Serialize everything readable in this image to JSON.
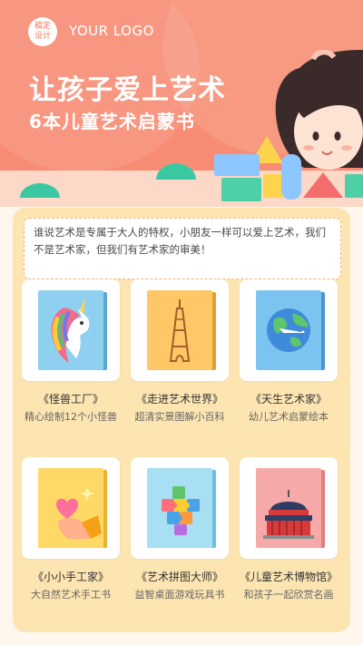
{
  "header": {
    "logo_badge_line1": "稿定",
    "logo_badge_line2": "设计",
    "logo_text": "YOUR LOGO",
    "title": "让孩子爱上艺术",
    "subtitle": "6本儿童艺术启蒙书"
  },
  "intro": {
    "text": "谁说艺术是专属于大人的特权，小朋友一样可以爱上艺术，我们不是艺术家，但我们有艺术家的审美！"
  },
  "books": [
    {
      "title": "《怪兽工厂》",
      "desc": "精心绘制12个小怪兽",
      "icon": "unicorn-icon",
      "cover_color": "#8fd0f0"
    },
    {
      "title": "《走进艺术世界》",
      "desc": "超清实景图解小百科",
      "icon": "eiffel-tower-icon",
      "cover_color": "#ffc766"
    },
    {
      "title": "《天生艺术家》",
      "desc": "幼儿艺术启蒙绘本",
      "icon": "globe-icon",
      "cover_color": "#7cc4f0"
    },
    {
      "title": "《小小手工家》",
      "desc": "大自然艺术手工书",
      "icon": "heart-hand-icon",
      "cover_color": "#ffd966"
    },
    {
      "title": "《艺术拼图大师》",
      "desc": "益智桌面游戏玩具书",
      "icon": "puzzle-icon",
      "cover_color": "#a8dff3"
    },
    {
      "title": "《儿童艺术博物馆》",
      "desc": "和孩子一起欣赏名画",
      "icon": "museum-icon",
      "cover_color": "#f6a9a9"
    }
  ],
  "colors": {
    "hero": "#f98c74",
    "panel": "#fde5b2",
    "background": "#fff7ee"
  }
}
